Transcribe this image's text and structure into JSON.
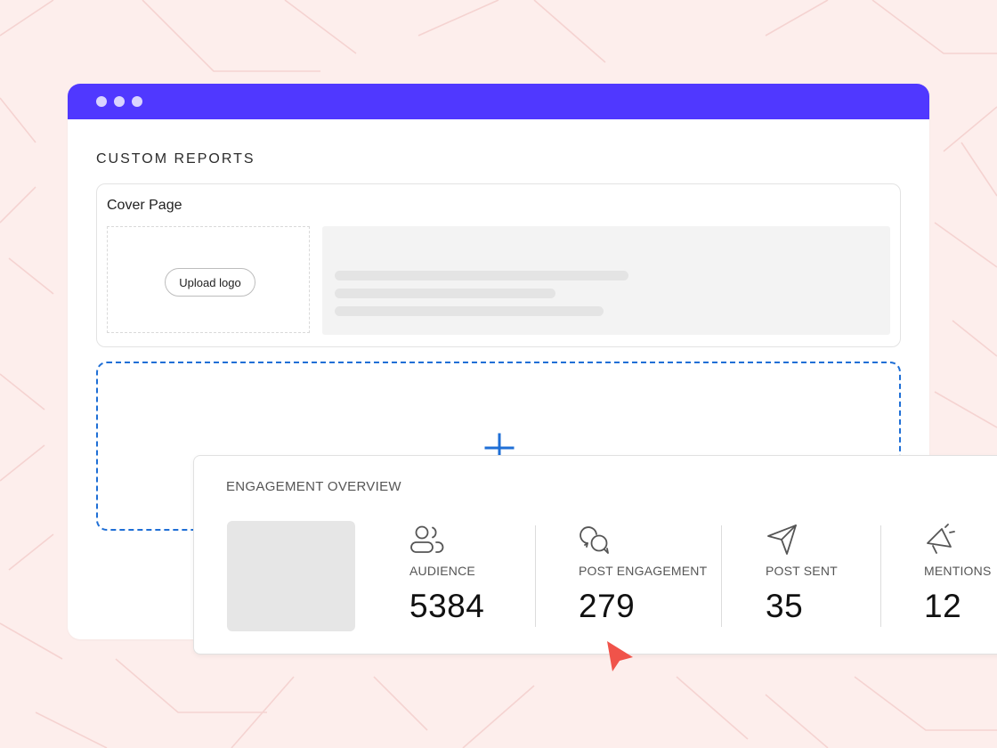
{
  "window": {
    "section_title": "CUSTOM REPORTS",
    "accent_color": "#5038ff"
  },
  "cover": {
    "title": "Cover Page",
    "upload_label": "Upload logo"
  },
  "dropzone": {
    "icon": "plus-icon",
    "accent_color": "#1f6fd6"
  },
  "engagement": {
    "title": "ENGAGEMENT OVERVIEW",
    "metrics": [
      {
        "icon": "audience-icon",
        "label": "AUDIENCE",
        "value": "5384"
      },
      {
        "icon": "post-engagement-icon",
        "label": "POST ENGAGEMENT",
        "value": "279"
      },
      {
        "icon": "paper-plane-icon",
        "label": "POST SENT",
        "value": "35"
      },
      {
        "icon": "megaphone-icon",
        "label": "MENTIONS",
        "value": "12"
      }
    ]
  },
  "cursor": {
    "icon": "cursor-arrow-icon",
    "color": "#f0534a"
  }
}
